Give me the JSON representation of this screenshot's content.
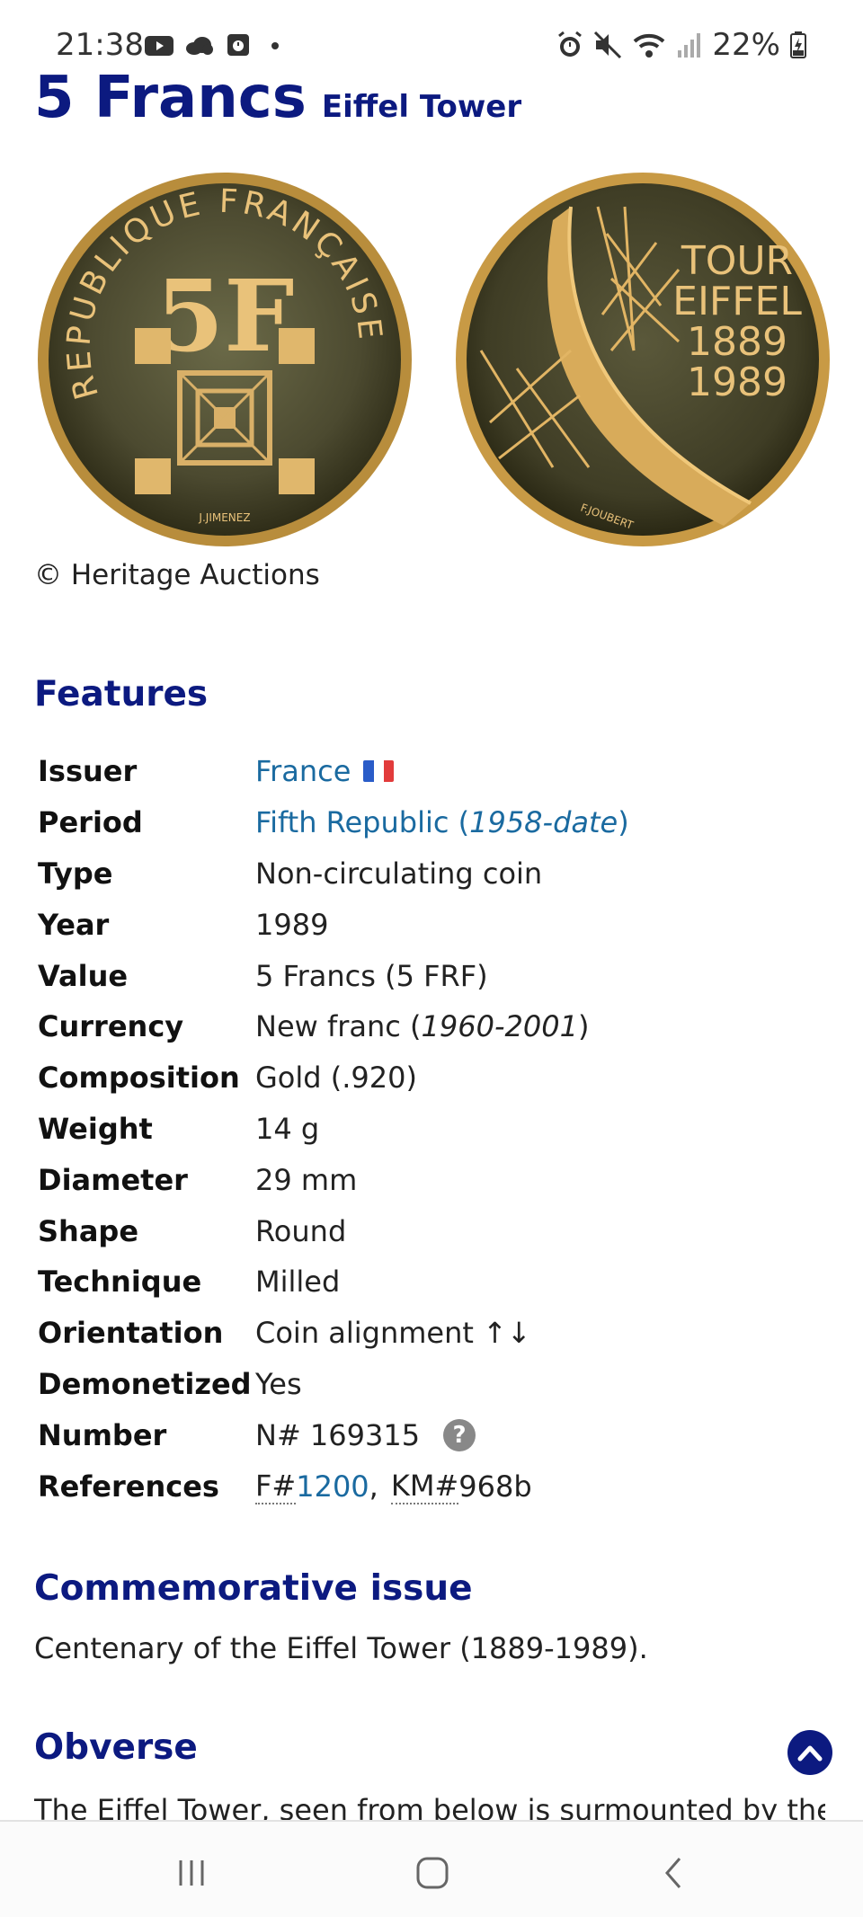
{
  "status_bar": {
    "time": "21:38",
    "battery": "22%",
    "left_icons": [
      "youtube-icon",
      "cloud-icon",
      "clock-app-icon",
      "dot-icon"
    ],
    "right_icons": [
      "alarm-icon",
      "mute-icon",
      "wifi-icon",
      "signal-icon",
      "battery-icon"
    ]
  },
  "title": {
    "main": "5 Francs",
    "sub": "Eiffel Tower"
  },
  "coin_images": {
    "obverse_text": "REPUBLIQUE FRANÇAISE",
    "obverse_center": "5F",
    "obverse_signature": "J.JIMENEZ",
    "reverse_lines": [
      "TOUR",
      "EIFFEL",
      "1889",
      "1989"
    ],
    "reverse_signature": "F.JOUBERT"
  },
  "copyright": "© Heritage Auctions",
  "features": {
    "heading": "Features",
    "rows": {
      "issuer": {
        "label": "Issuer",
        "value": "France"
      },
      "period": {
        "label": "Period",
        "value": "Fifth Republic (",
        "value_italic": "1958-date",
        "value_end": ")"
      },
      "type": {
        "label": "Type",
        "value": "Non-circulating coin"
      },
      "year": {
        "label": "Year",
        "value": "1989"
      },
      "value": {
        "label": "Value",
        "value": "5 Francs (5 FRF)"
      },
      "currency": {
        "label": "Currency",
        "value": "New franc (",
        "value_italic": "1960-2001",
        "value_end": ")"
      },
      "composition": {
        "label": "Composition",
        "value": "Gold (.920)"
      },
      "weight": {
        "label": "Weight",
        "value": "14 g"
      },
      "diameter": {
        "label": "Diameter",
        "value": "29 mm"
      },
      "shape": {
        "label": "Shape",
        "value": "Round"
      },
      "technique": {
        "label": "Technique",
        "value": "Milled"
      },
      "orientation": {
        "label": "Orientation",
        "value": "Coin alignment ↑↓"
      },
      "demonetized": {
        "label": "Demonetized",
        "value": "Yes"
      },
      "number": {
        "label": "Number",
        "value": "N# 169315",
        "help": "?"
      },
      "references": {
        "label": "References",
        "ref1_prefix": "F#",
        "ref1_number": "1200",
        "separator": ",",
        "ref2_prefix": "KM#",
        "ref2_number": "968b"
      }
    }
  },
  "commemorative": {
    "heading": "Commemorative issue",
    "text": "Centenary of the Eiffel Tower (1889-1989)."
  },
  "obverse": {
    "heading": "Obverse",
    "text": "The Eiffel Tower, seen from below is surmounted by the"
  },
  "colors": {
    "heading": "#0c1a80",
    "link": "#1a6aa0",
    "gold": "#c9a24a",
    "flag_blue": "#2a5cc8",
    "flag_white": "#ffffff",
    "flag_red": "#e23b3b"
  }
}
